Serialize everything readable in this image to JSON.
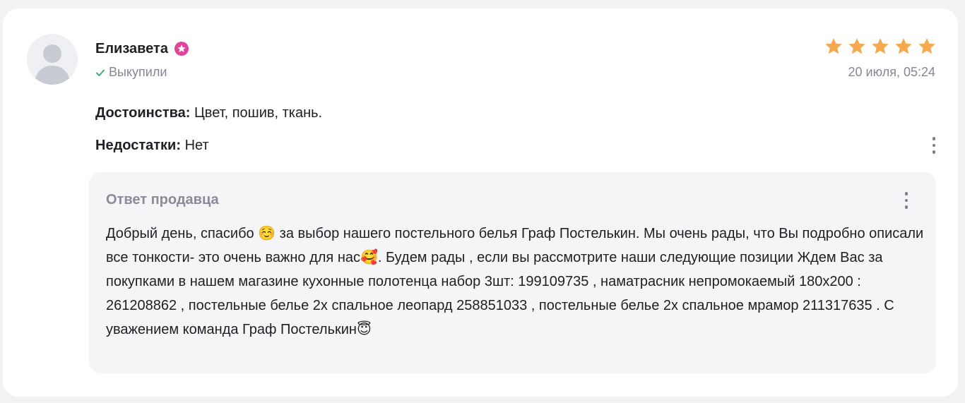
{
  "review": {
    "author": "Елизавета",
    "badge_icon": "premium-badge-icon",
    "purchase_status": "Выкупили",
    "rating": 5,
    "rating_max": 5,
    "date": "20 июля, 05:24",
    "pros_label": "Достоинства:",
    "pros_text": " Цвет, пошив, ткань.",
    "cons_label": "Недостатки:",
    "cons_text": " Нет"
  },
  "seller_reply": {
    "title": "Ответ продавца",
    "text": "Добрый день, спасибо ☺️ за выбор нашего постельного белья Граф Постелькин. Мы очень рады, что Вы подробно описали все тонкости- это очень важно для нас🥰. Будем рады , если вы рассмотрите наши следующие позиции Ждем Вас за покупками в нашем магазине кухонные полотенца набор 3шт: 199109735 , наматрасник непромокаемый 180х200 : 261208862 , постельные белье 2х спальное леопард 258851033 , постельные белье 2х спальное мрамор 211317635 . С уважением команда Граф Постелькин😇"
  },
  "colors": {
    "star": "#f6a94f",
    "badge": "#e0459a",
    "check": "#36b37e",
    "muted": "#868695",
    "reply_bg": "#f5f5f7"
  }
}
